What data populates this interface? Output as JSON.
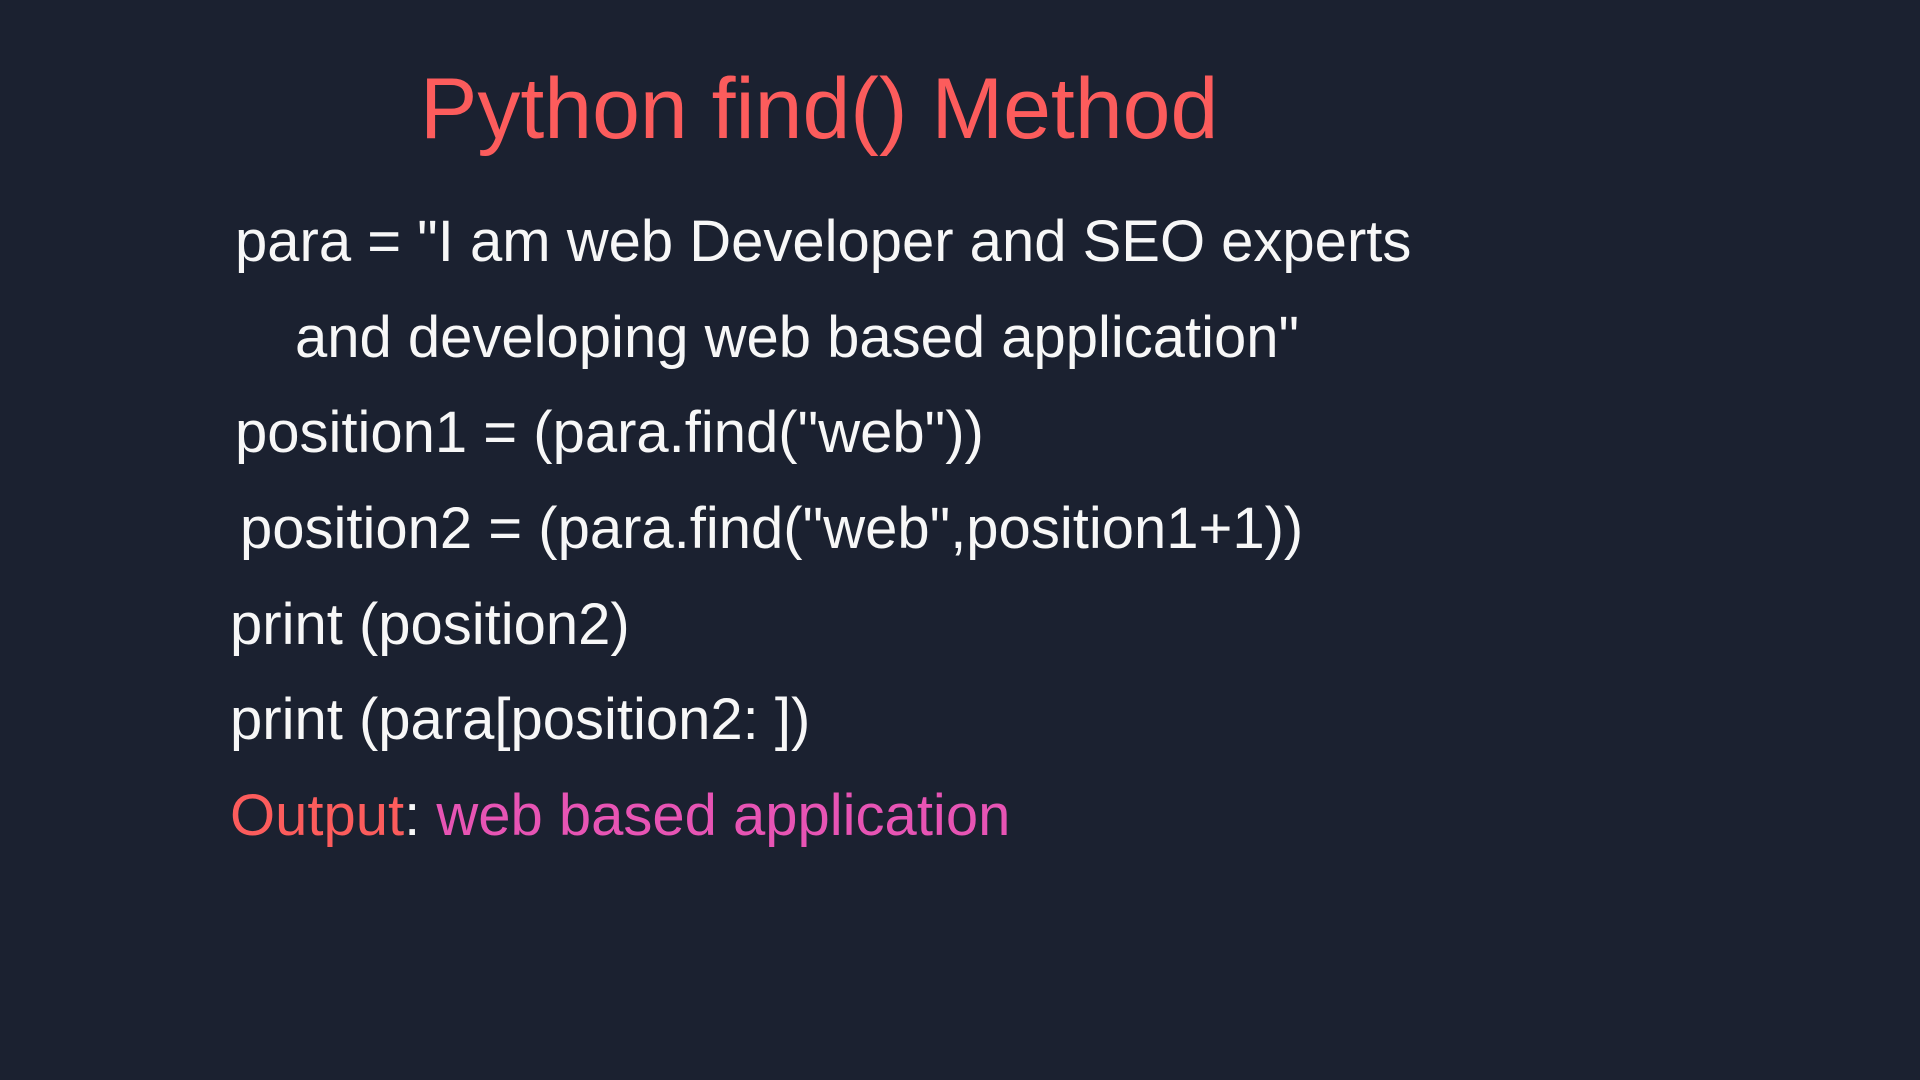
{
  "title": "Python find() Method",
  "code": {
    "line1": "para = \"I am web Developer and SEO experts",
    "line2": "and developing web based application\"",
    "line3": "position1 = (para.find(\"web\"))",
    "line4": "position2 = (para.find(\"web\",position1+1))",
    "line5": "print (position2)",
    "line6": "print (para[position2: ])"
  },
  "output": {
    "label": "Output",
    "colon": ": ",
    "value": "web based application"
  }
}
